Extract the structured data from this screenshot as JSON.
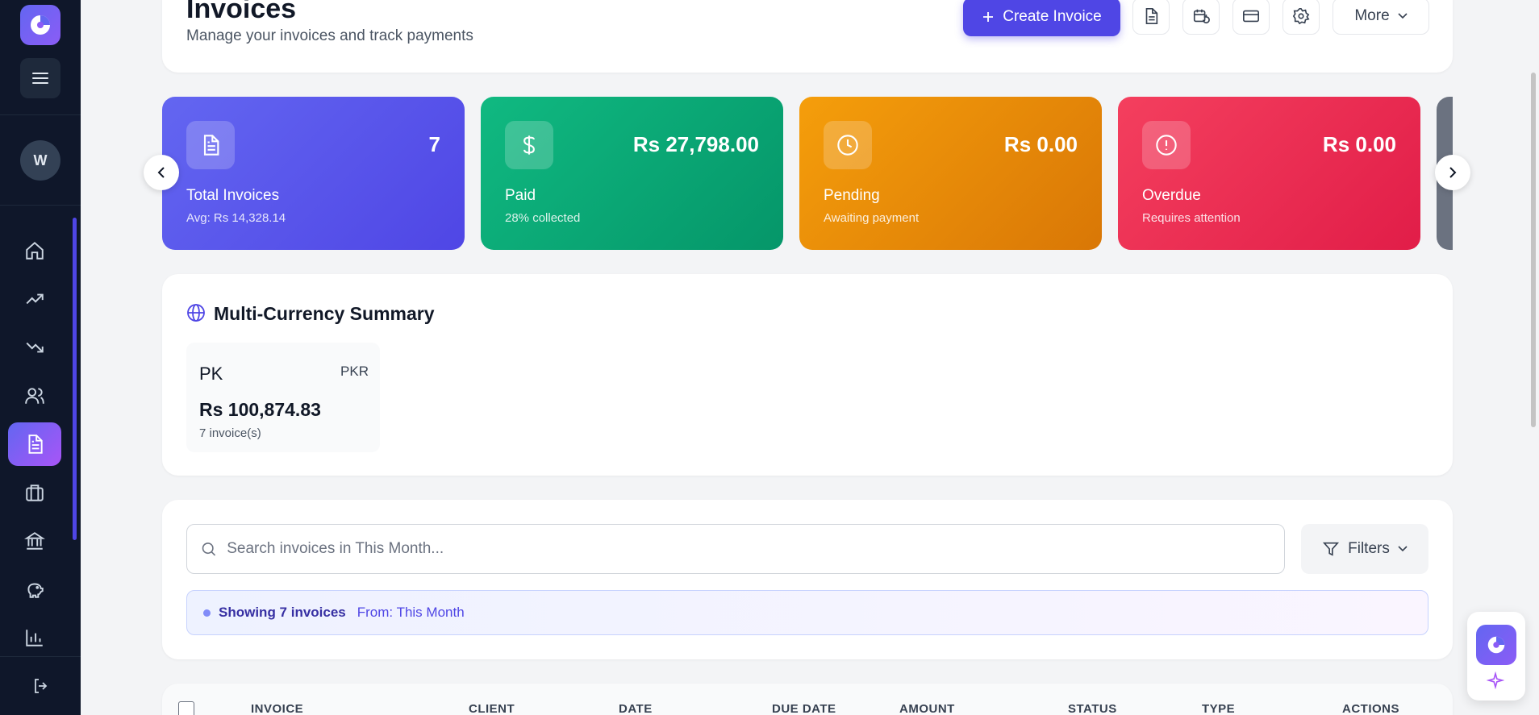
{
  "app": {
    "user_initial": "W",
    "accent_color": "#4f46e5"
  },
  "header": {
    "title": "Invoices",
    "subtitle": "Manage your invoices and track payments",
    "create_label": "Create Invoice",
    "more_label": "More",
    "icon_buttons": [
      "document-icon",
      "calendar-refresh-icon",
      "credit-card-icon",
      "gear-icon"
    ]
  },
  "sidebar": {
    "items": [
      {
        "icon": "home-icon",
        "active": false
      },
      {
        "icon": "trending-up-icon",
        "active": false
      },
      {
        "icon": "trending-down-icon",
        "active": false
      },
      {
        "icon": "users-icon",
        "active": false
      },
      {
        "icon": "invoice-icon",
        "active": true
      },
      {
        "icon": "briefcase-icon",
        "active": false
      },
      {
        "icon": "bank-icon",
        "active": false
      },
      {
        "icon": "piggy-bank-icon",
        "active": false
      },
      {
        "icon": "bar-chart-icon",
        "active": false
      }
    ]
  },
  "stats": [
    {
      "label": "Total Invoices",
      "value": "7",
      "sub": "Avg: Rs 14,328.14",
      "icon": "document-icon",
      "color": "#5b5bf0"
    },
    {
      "label": "Paid",
      "value": "Rs 27,798.00",
      "sub": "28% collected",
      "icon": "dollar-icon",
      "color": "#10b981"
    },
    {
      "label": "Pending",
      "value": "Rs 0.00",
      "sub": "Awaiting payment",
      "icon": "clock-icon",
      "color": "#f59e0b"
    },
    {
      "label": "Overdue",
      "value": "Rs 0.00",
      "sub": "Requires attention",
      "icon": "alert-circle-icon",
      "color": "#f43f5e"
    }
  ],
  "currency_summary": {
    "title": "Multi-Currency Summary",
    "items": [
      {
        "code": "PK",
        "currency": "PKR",
        "amount": "Rs 100,874.83",
        "count": "7 invoice(s)"
      }
    ]
  },
  "search": {
    "placeholder": "Search invoices in This Month...",
    "value": "",
    "filters_label": "Filters",
    "showing_main": "Showing 7 invoices",
    "showing_sub": "From: This Month"
  },
  "table": {
    "columns": [
      "INVOICE",
      "CLIENT",
      "DATE",
      "DUE DATE",
      "AMOUNT",
      "STATUS",
      "TYPE",
      "ACTIONS"
    ]
  }
}
